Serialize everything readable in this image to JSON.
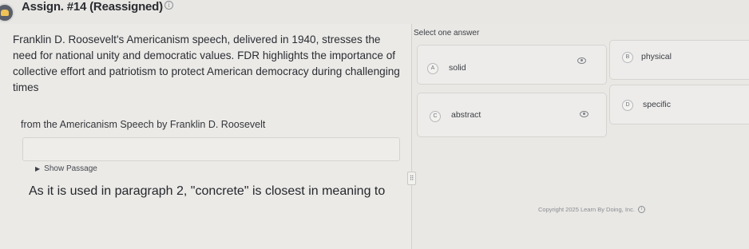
{
  "header": {
    "title": "Assign. #14 (Reassigned)",
    "info_icon": "info-icon"
  },
  "question_panel": {
    "stem": "Franklin D. Roosevelt's Americanism speech, delivered in 1940, stresses the need for national unity and democratic values. FDR highlights the importance of collective effort and patriotism to protect American democracy during challenging times",
    "source": "from the Americanism Speech by Franklin D. Roosevelt",
    "show_passage_label": "Show Passage",
    "question": "As it is used in paragraph 2, \"concrete\" is closest in meaning to"
  },
  "answer_panel": {
    "instruction": "Select one answer",
    "options": [
      {
        "letter": "A",
        "text": "solid"
      },
      {
        "letter": "B",
        "text": "physical"
      },
      {
        "letter": "C",
        "text": "abstract"
      },
      {
        "letter": "D",
        "text": "specific"
      }
    ]
  },
  "footer": {
    "copyright": "Copyright 2025 Learn By Doing, Inc."
  }
}
